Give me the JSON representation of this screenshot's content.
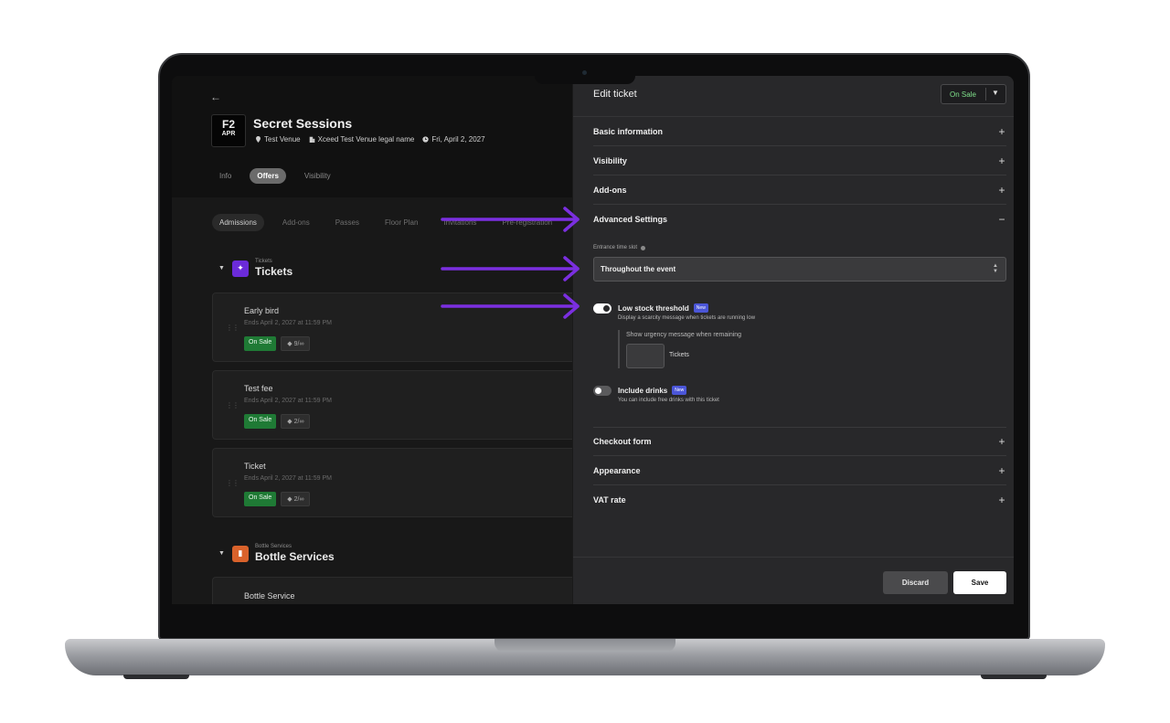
{
  "event": {
    "thumb_code": "F2",
    "thumb_month": "APR",
    "title": "Secret Sessions",
    "venue": "Test Venue",
    "legal_name": "Xceed Test Venue legal name",
    "date": "Fri, April 2, 2027"
  },
  "tabs": [
    "Info",
    "Offers",
    "Visibility"
  ],
  "subtabs": [
    "Admissions",
    "Add-ons",
    "Passes",
    "Floor Plan",
    "Invitations",
    "Pre-registration"
  ],
  "tickets_section": {
    "small": "Tickets",
    "large": "Tickets"
  },
  "tickets": [
    {
      "name": "Early bird",
      "ends": "Ends April 2, 2027 at 11:59 PM",
      "status": "On Sale",
      "qty": "9/∞"
    },
    {
      "name": "Test fee",
      "ends": "Ends April 2, 2027 at 11:59 PM",
      "status": "On Sale",
      "qty": "2/∞"
    },
    {
      "name": "Ticket",
      "ends": "Ends April 2, 2027 at 11:59 PM",
      "status": "On Sale",
      "qty": "2/∞"
    }
  ],
  "bottle_section": {
    "small": "Bottle Services",
    "large": "Bottle Services"
  },
  "bottle_item": {
    "name": "Bottle Service"
  },
  "drawer": {
    "title": "Edit ticket",
    "status": "On Sale",
    "sections": {
      "basic": "Basic information",
      "visibility": "Visibility",
      "addons": "Add-ons",
      "advanced": "Advanced Settings",
      "checkout": "Checkout form",
      "appearance": "Appearance",
      "vat": "VAT rate"
    },
    "entrance_label": "Entrance time slot",
    "entrance_value": "Throughout the event",
    "low_stock": {
      "title": "Low stock threshold",
      "badge": "New",
      "desc": "Display a scarcity message when tickets are running low",
      "sub_label": "Show urgency message when remaining",
      "unit": "Tickets",
      "enabled": true
    },
    "drinks": {
      "title": "Include drinks",
      "badge": "New",
      "desc": "You can include free drinks with this ticket",
      "enabled": false
    },
    "discard": "Discard",
    "save": "Save"
  },
  "colors": {
    "accent_arrow": "#7b2fe0",
    "on_sale": "#1f7a35",
    "new_badge": "#4b56d8"
  }
}
